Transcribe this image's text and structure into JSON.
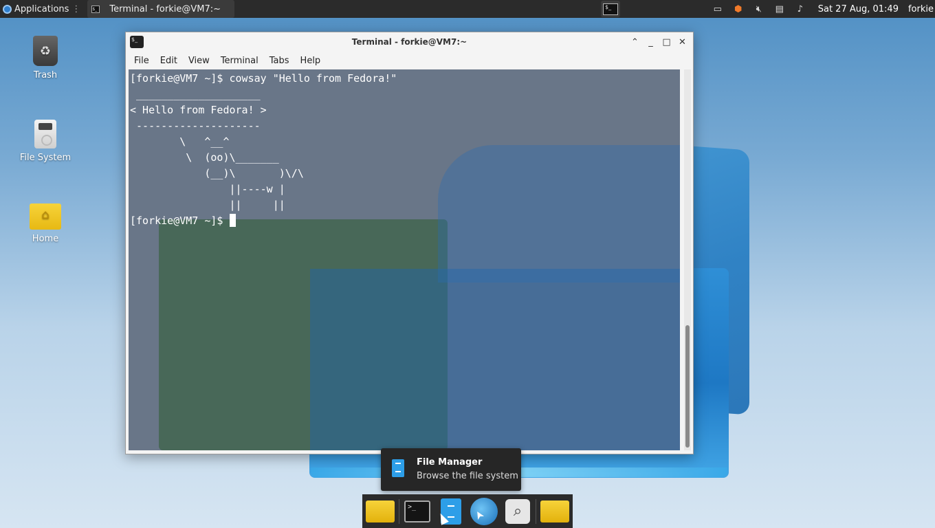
{
  "top_panel": {
    "applications_label": "Applications",
    "task_title": "Terminal - forkie@VM7:~",
    "clock": "Sat 27 Aug, 01:49",
    "user": "forkie",
    "tray_icons": [
      "display-icon",
      "package-updater-icon",
      "volume-muted-icon",
      "clipboard-icon",
      "notification-bell-icon"
    ]
  },
  "desktop": {
    "icons": [
      {
        "label": "Trash",
        "icon": "trash-icon"
      },
      {
        "label": "File System",
        "icon": "drive-icon"
      },
      {
        "label": "Home",
        "icon": "home-folder-icon"
      }
    ]
  },
  "terminal_window": {
    "title": "Terminal - forkie@VM7:~",
    "menu": [
      "File",
      "Edit",
      "View",
      "Terminal",
      "Tabs",
      "Help"
    ],
    "lines": [
      "[forkie@VM7 ~]$ cowsay \"Hello from Fedora!\"",
      " ____________________",
      "< Hello from Fedora! >",
      " --------------------",
      "        \\   ^__^",
      "         \\  (oo)\\_______",
      "            (__)\\       )\\/\\",
      "                ||----w |",
      "                ||     ||"
    ],
    "prompt": "[forkie@VM7 ~]$ "
  },
  "tooltip": {
    "title": "File Manager",
    "description": "Browse the file system"
  },
  "dock": {
    "items": [
      "folder-icon",
      "terminal-icon",
      "file-manager-icon",
      "web-browser-icon",
      "search-icon",
      "home-folder-icon"
    ]
  }
}
